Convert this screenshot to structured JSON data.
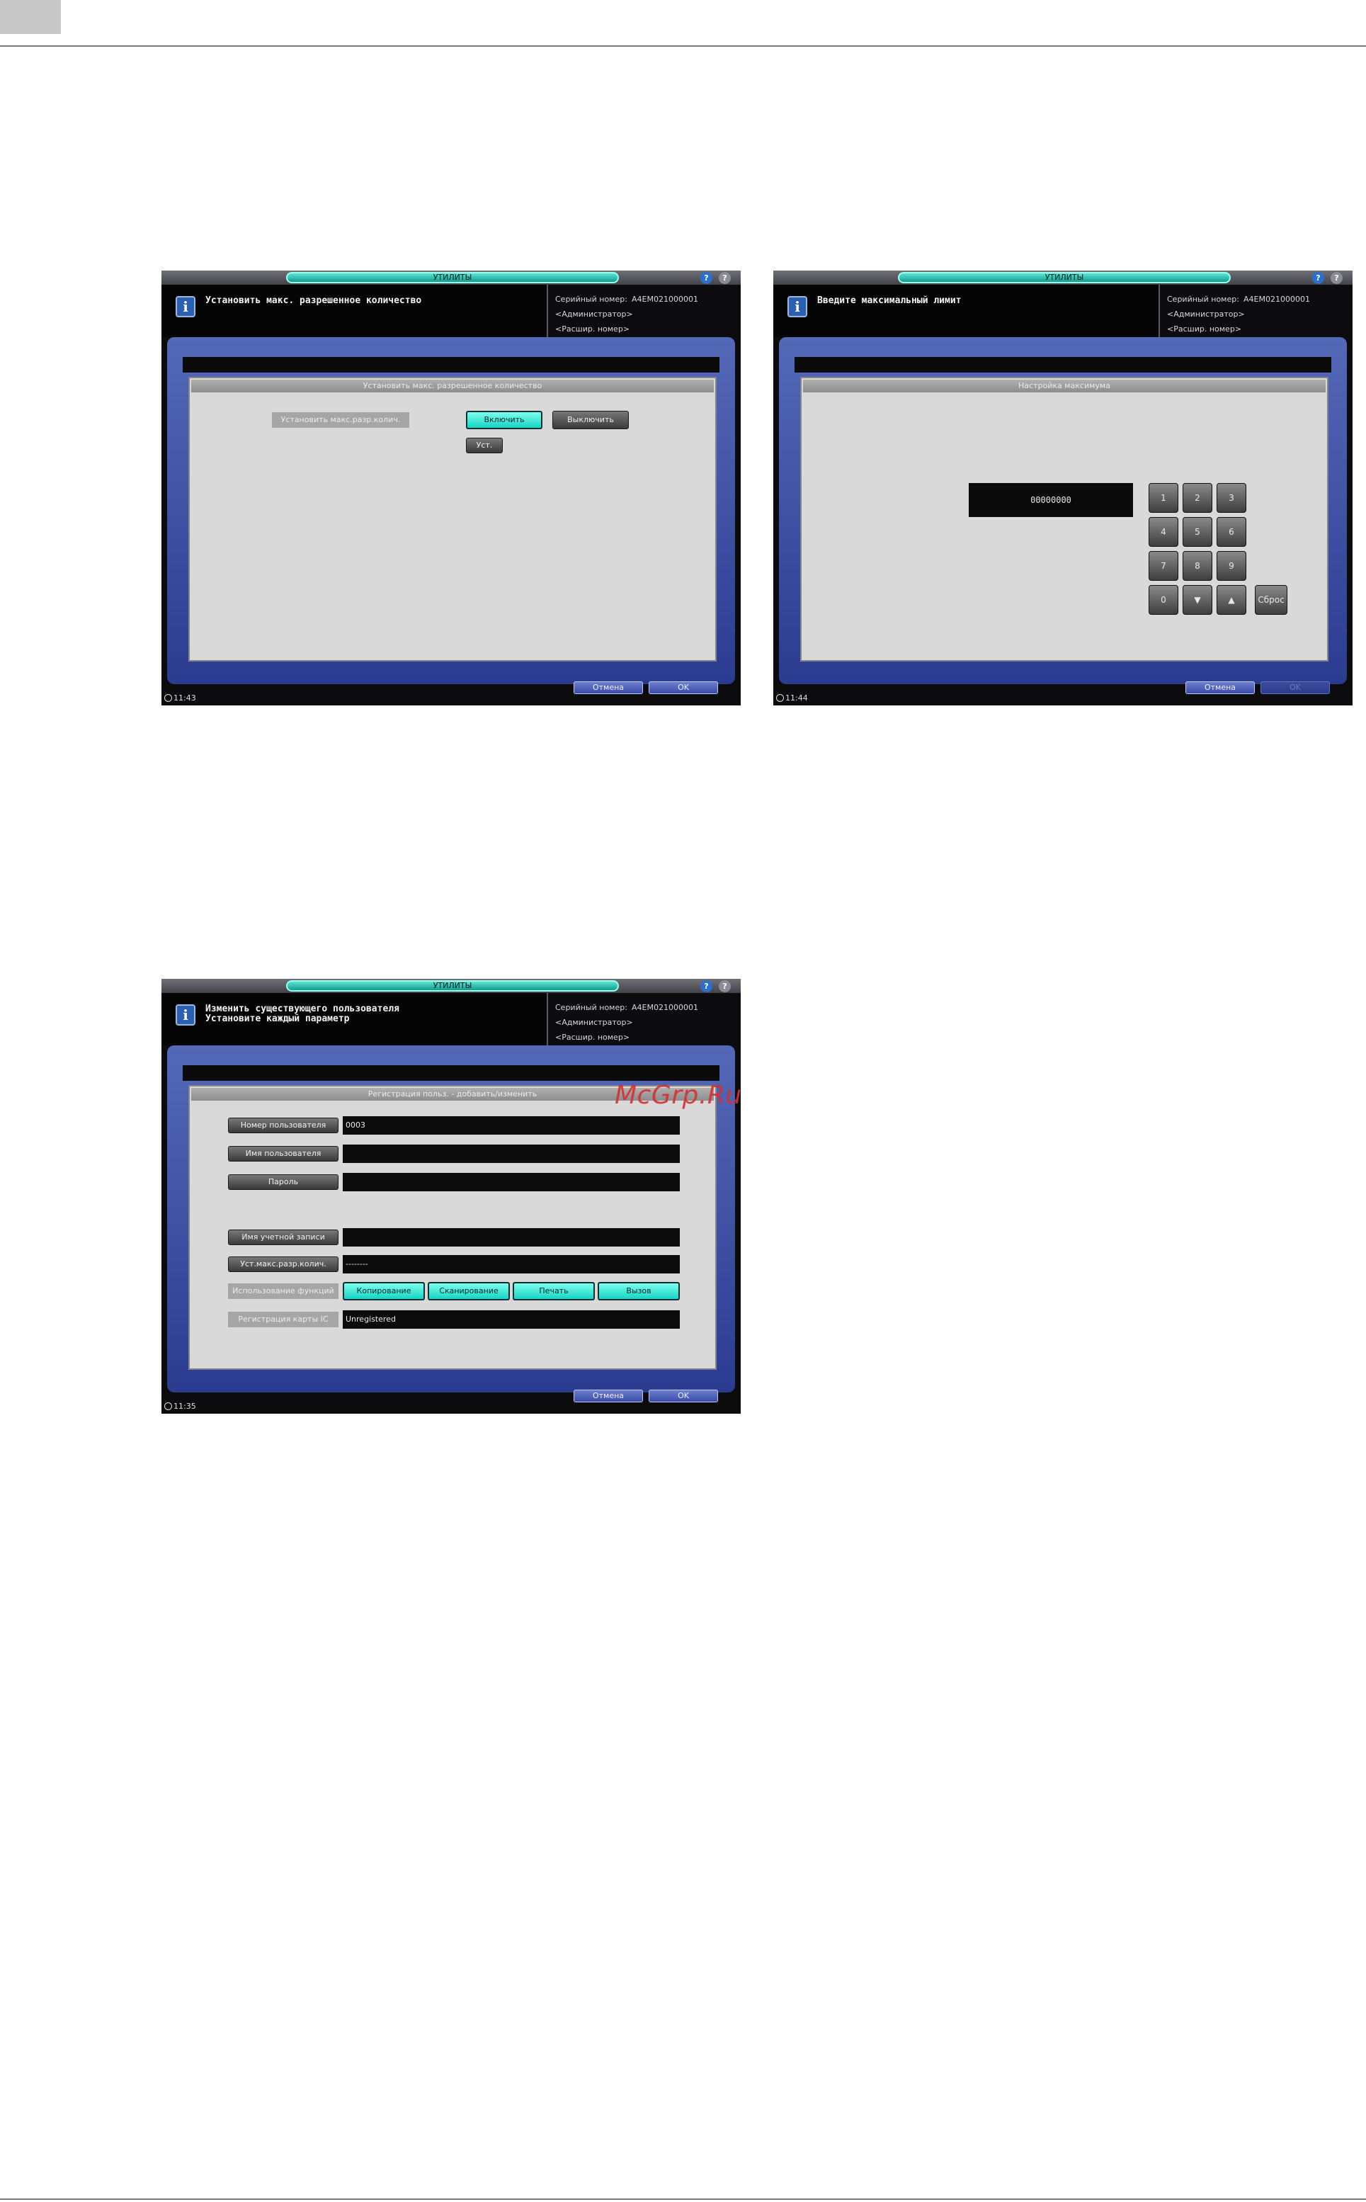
{
  "screen1": {
    "title": "УТИЛИТЫ",
    "help1": "?",
    "help2": "?",
    "message": "Установить макс. разрешенное количество",
    "serial_label": "Серийный номер:",
    "serial_value": "A4EM021000001",
    "admin": "<Администратор>",
    "ext_number": "<Расшир. номер>",
    "panel_title": "Установить макс. разрешенное количество",
    "setting_label": "Установить макс.разр.колич.",
    "on_button": "Включить",
    "off_button": "Выключить",
    "set_button": "Уст.",
    "cancel_button": "Отмена",
    "ok_button": "OK",
    "clock": "11:43"
  },
  "screen2": {
    "title": "УТИЛИТЫ",
    "help1": "?",
    "help2": "?",
    "message": "Введите максимальный лимит",
    "serial_label": "Серийный номер:",
    "serial_value": "A4EM021000001",
    "admin": "<Администратор>",
    "ext_number": "<Расшир. номер>",
    "panel_title": "Настройка максимума",
    "display_value": "00000000",
    "keys": [
      "1",
      "2",
      "3",
      "4",
      "5",
      "6",
      "7",
      "8",
      "9",
      "0",
      "▼",
      "▲"
    ],
    "reset_button": "Сброс",
    "cancel_button": "Отмена",
    "ok_button": "OK",
    "clock": "11:44"
  },
  "screen3": {
    "title": "УТИЛИТЫ",
    "help1": "?",
    "help2": "?",
    "message_line1": "Изменить существующего пользователя",
    "message_line2": "Установите каждый параметр",
    "serial_label": "Серийный номер:",
    "serial_value": "A4EM021000001",
    "admin": "<Администратор>",
    "ext_number": "<Расшир. номер>",
    "panel_title": "Регистрация польз. - добавить/изменить",
    "user_number_button": "Номер пользователя",
    "user_number_value": "0003",
    "user_name_button": "Имя пользователя",
    "user_name_value": "",
    "password_button": "Пароль",
    "password_value": "",
    "account_name_button": "Имя учетной записи",
    "account_name_value": "",
    "max_count_button": "Уст.макс.разр.колич.",
    "max_count_value": "--------",
    "functions_label": "Использование функций",
    "function_buttons": [
      "Копирование",
      "Сканирование",
      "Печать",
      "Вызов"
    ],
    "ic_card_label": "Регистрация карты IC",
    "ic_card_value": "Unregistered",
    "cancel_button": "Отмена",
    "ok_button": "OK",
    "clock": "11:35"
  },
  "watermark": "McGrp.Ru",
  "colors": {
    "accent_cyan": "#16d4c4",
    "frame_blue": "#3a4ba6",
    "panel_grey": "#d9d9d9"
  }
}
